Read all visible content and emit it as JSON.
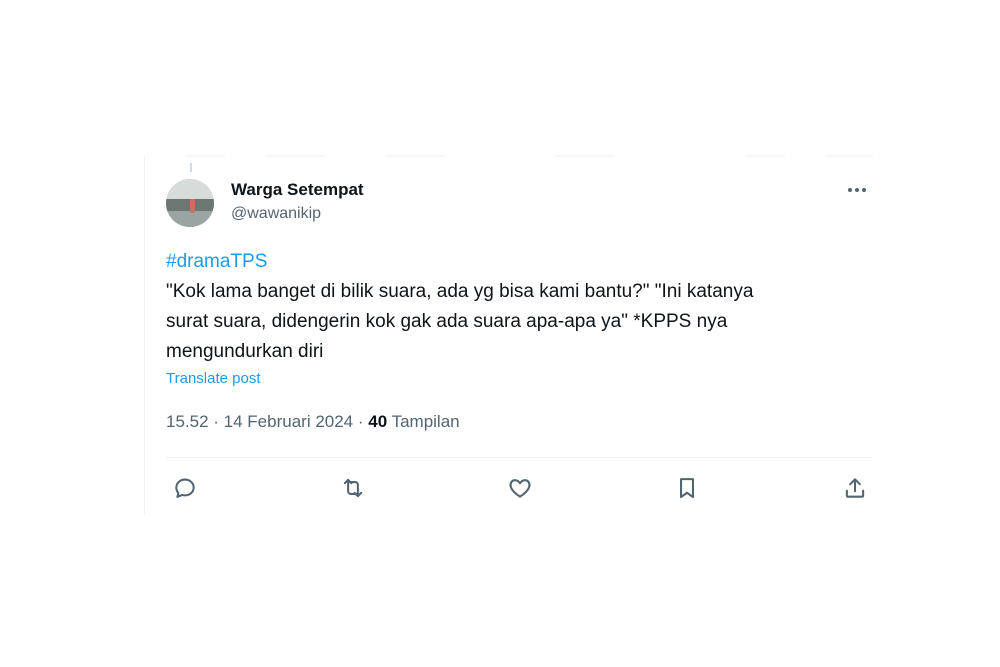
{
  "author": {
    "name": "Warga Setempat",
    "handle": "@wawanikip"
  },
  "post": {
    "hashtag": "#dramaTPS",
    "line1": "\"Kok lama banget di bilik suara, ada yg bisa kami bantu?\" \"Ini katanya",
    "line2": "surat suara, didengerin kok gak ada suara apa-apa ya\" *KPPS nya",
    "line3": "mengundurkan diri",
    "translate_label": "Translate post"
  },
  "meta": {
    "time": "15.52",
    "separator1": " · ",
    "date": "14 Februari 2024",
    "separator2": " · ",
    "views_count": "40",
    "views_label": " Tampilan"
  },
  "actions": {
    "icons": [
      "reply-icon",
      "repost-icon",
      "like-icon",
      "bookmark-icon",
      "share-icon"
    ]
  },
  "colors": {
    "text": "#0f1419",
    "secondary": "#536471",
    "accent": "#1d9bf0",
    "divider": "#eff3f4"
  }
}
